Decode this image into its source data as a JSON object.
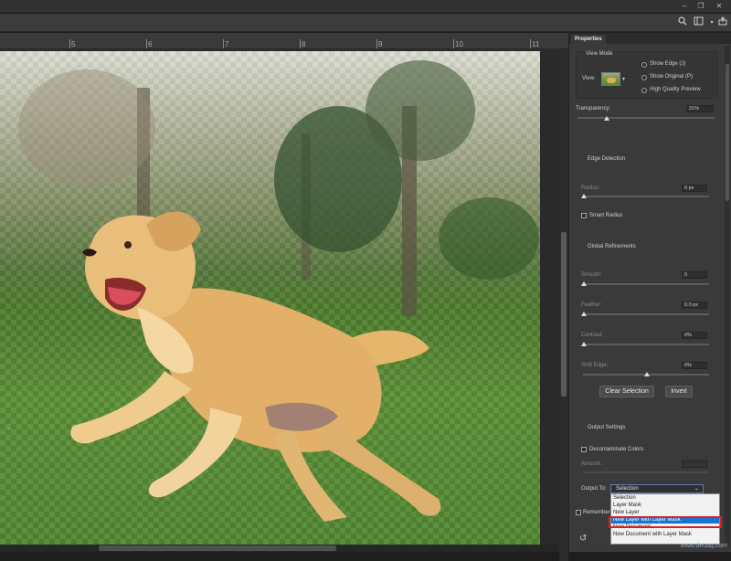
{
  "window": {
    "minimize": "–",
    "restore": "❐",
    "close": "✕"
  },
  "toolbar_icons": [
    "search-icon",
    "view-icon",
    "share-icon"
  ],
  "ruler": {
    "labels": [
      "5",
      "6",
      "7",
      "8",
      "9",
      "10",
      "11"
    ]
  },
  "panel": {
    "tab": "Properties",
    "view_mode": {
      "section_title": "View Mode",
      "view_label": "View:",
      "show_edge": "Show Edge (J)",
      "show_original": "Show Original (P)",
      "high_quality": "High Quality Preview"
    },
    "transparency": {
      "label": "Transparency:",
      "value": "21%",
      "fraction": 0.21
    },
    "edge_detection": {
      "title": "Edge Detection",
      "radius_label": "Radius:",
      "radius_value": "0 px",
      "smart_radius": "Smart Radius"
    },
    "global_refinements": {
      "title": "Global Refinements",
      "smooth_label": "Smooth:",
      "smooth_value": "0",
      "feather_label": "Feather:",
      "feather_value": "0.0 px",
      "contrast_label": "Contrast:",
      "contrast_value": "0%",
      "shift_edge_label": "Shift Edge:",
      "shift_edge_value": "0%"
    },
    "buttons": {
      "clear_selection": "Clear Selection",
      "invert": "Invert"
    },
    "output_settings": {
      "title": "Output Settings",
      "decontaminate": "Decontaminate Colors",
      "amount_label": "Amount:",
      "output_to_label": "Output To:",
      "output_to_value": "Selection",
      "remember_label": "Remember",
      "options": [
        "Selection",
        "Layer Mask",
        "New Layer",
        "New Layer with Layer Mask",
        "New Document",
        "New Document with Layer Mask"
      ],
      "highlighted_option": "New Layer with Layer Mask"
    }
  },
  "watermark": "www.deuaq.com"
}
